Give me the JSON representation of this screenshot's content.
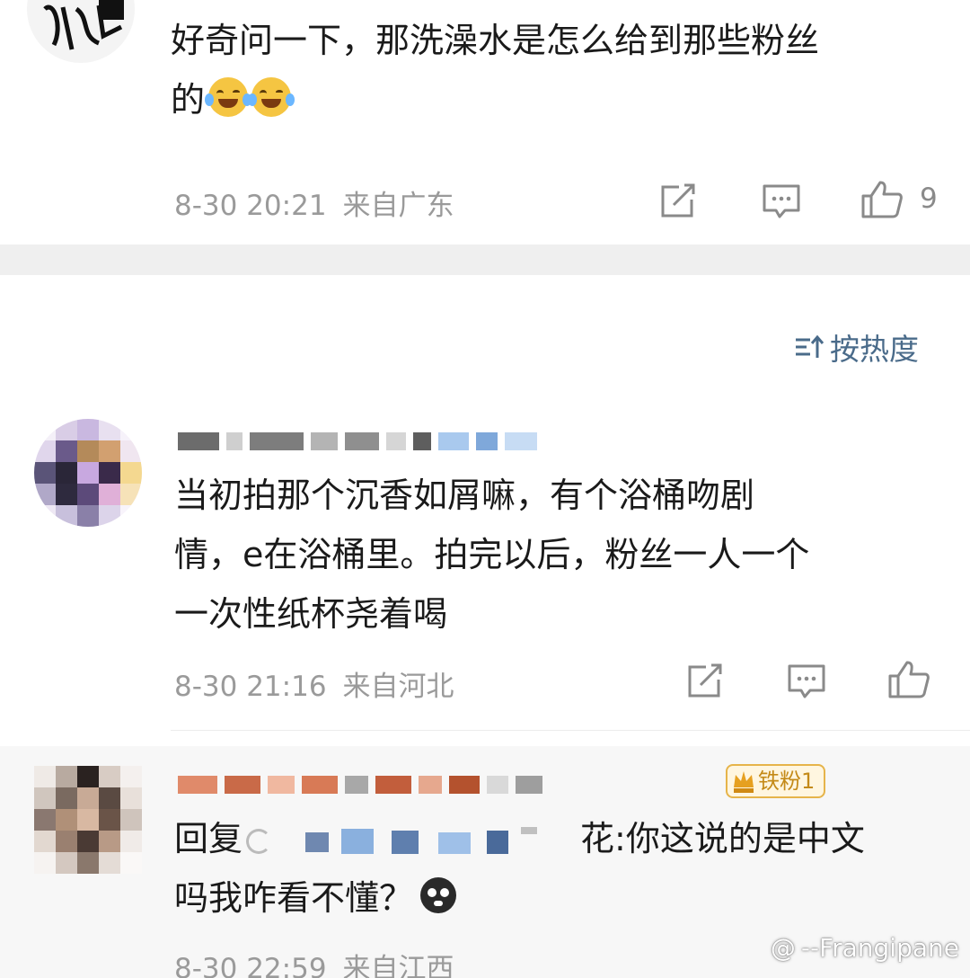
{
  "comments": [
    {
      "text_line1": "好奇问一下，那洗澡水是怎么给到那些粉丝",
      "text_line2": "的",
      "emoji_icon": "laugh-cry-emoji-icon",
      "time": "8-30 20:21",
      "location": "来自广东",
      "likes": "9"
    },
    {
      "text_line1": "当初拍那个沉香如屑嘛，有个浴桶吻剧",
      "text_line2": "情，e在浴桶里。拍完以后，粉丝一人一个",
      "text_line3": "一次性纸杯尧着喝",
      "time": "8-30 21:16",
      "location": "来自河北",
      "likes": ""
    },
    {
      "reply_prefix": "回复",
      "reply_target_tail": "花",
      "text_line1": ":你这说的是中文",
      "text_line2": "吗我咋看不懂？",
      "emoji_icon": "crying-face-emoji-icon",
      "badge": "铁粉1",
      "time": "8-30 22:59",
      "location": "来自江西"
    }
  ],
  "sort": {
    "label": "按热度",
    "icon": "sort-icon"
  },
  "watermark": {
    "at": "@",
    "handle": "--Frangipane"
  },
  "colors": {
    "gap": "#efefef",
    "meta_text": "#9a9a9a",
    "sort_text": "#4a6b8a",
    "badge": "#e6b44a"
  }
}
